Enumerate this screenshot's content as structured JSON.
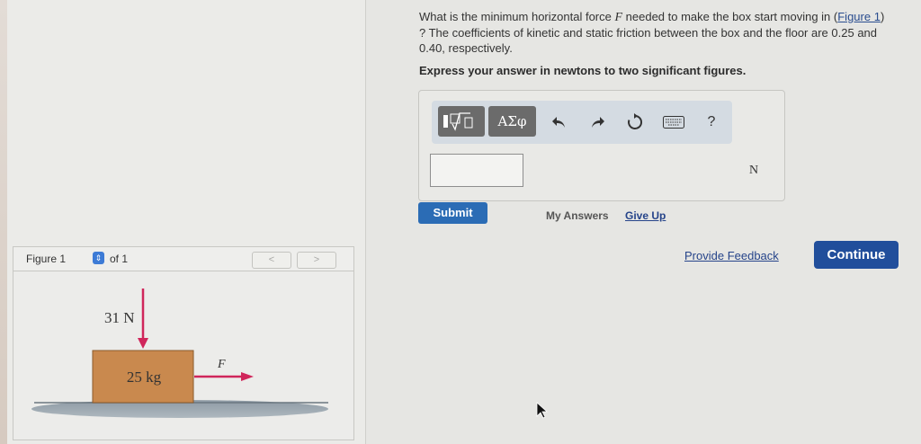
{
  "figure_panel": {
    "label": "Figure 1",
    "of_text": "of 1",
    "prev": "<",
    "next": ">"
  },
  "diagram": {
    "downward_force": "31 N",
    "mass": "25 kg",
    "applied_force": "F"
  },
  "question": {
    "part1": "What is the minimum horizontal force ",
    "var": "F",
    "part2": " needed to make the box start moving in ",
    "paren_open": "(",
    "figure_link": "Figure 1",
    "part3": ") ? The coefficients of kinetic and static friction between the box and the floor are 0.25 and 0.40, respectively.",
    "instruction": "Express your answer in newtons to two significant figures."
  },
  "toolbar": {
    "greek_label": "ΑΣφ",
    "help_label": "?"
  },
  "answer": {
    "value": "",
    "unit": "N"
  },
  "actions": {
    "submit": "Submit",
    "my_answers": "My Answers",
    "give_up": "Give Up",
    "provide_feedback": "Provide Feedback",
    "continue": "Continue"
  },
  "colors": {
    "link": "#26448a",
    "submit": "#2b6cb5",
    "continue": "#214e9b",
    "box": "#c9894e",
    "force_arrow": "#d0265b"
  }
}
